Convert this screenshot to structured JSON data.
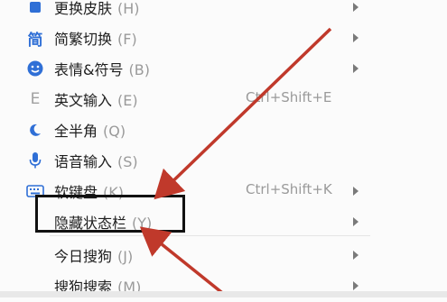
{
  "menu": {
    "items": [
      {
        "label": "更换皮肤",
        "key": "(H)",
        "icon": "skin-icon",
        "submenu": true
      },
      {
        "label": "简繁切换",
        "key": "(F)",
        "icon": "simplified-traditional-icon",
        "icon_text": "简",
        "submenu": true
      },
      {
        "label": "表情&符号",
        "key": "(B)",
        "icon": "emoji-icon",
        "submenu": true
      },
      {
        "label": "英文输入",
        "key": "(E)",
        "icon": "english-input-icon",
        "icon_text": "E",
        "shortcut": "Ctrl+Shift+E"
      },
      {
        "label": "全半角",
        "key": "(Q)",
        "icon": "half-moon-icon"
      },
      {
        "label": "语音输入",
        "key": "(S)",
        "icon": "microphone-icon"
      },
      {
        "label": "软键盘",
        "key": "(K)",
        "icon": "keyboard-icon",
        "shortcut": "Ctrl+Shift+K",
        "submenu": true
      },
      {
        "label": "隐藏状态栏",
        "key": "(Y)",
        "submenu": true,
        "highlighted": true
      },
      {
        "label": "今日搜狗",
        "key": "(J)",
        "submenu": true
      },
      {
        "label": "搜狗搜索",
        "key": "(M)",
        "submenu": true
      }
    ]
  },
  "colors": {
    "icon_blue": "#2f6fd6",
    "arrow_red": "#c0392b",
    "highlight_border": "#111111"
  }
}
